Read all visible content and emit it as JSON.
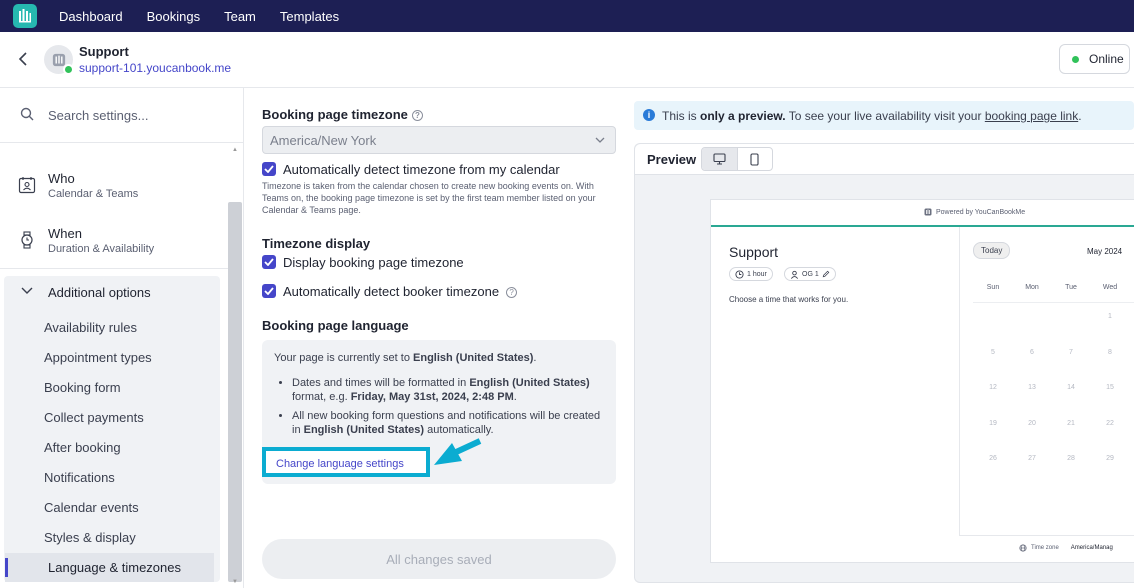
{
  "nav": {
    "items": [
      "Dashboard",
      "Bookings",
      "Team",
      "Templates"
    ]
  },
  "header": {
    "title": "Support",
    "url": "support-101.youcanbook.me",
    "status": "Online"
  },
  "sidebar": {
    "search_placeholder": "Search settings...",
    "sections": [
      {
        "title": "Who",
        "subtitle": "Calendar & Teams"
      },
      {
        "title": "When",
        "subtitle": "Duration & Availability"
      }
    ],
    "additional": {
      "title": "Additional options",
      "items": [
        "Availability rules",
        "Appointment types",
        "Booking form",
        "Collect payments",
        "After booking",
        "Notifications",
        "Calendar events",
        "Styles & display"
      ],
      "active": "Language & timezones"
    }
  },
  "settings": {
    "tz_label": "Booking page timezone",
    "tz_value": "America/New York",
    "auto_detect_label": "Automatically detect timezone from my calendar",
    "help_text": "Timezone is taken from the calendar chosen to create new booking events on. With Teams on, the booking page timezone is set by the first team member listed on your Calendar & Teams page.",
    "tz_display_label": "Timezone display",
    "display_booking_tz": "Display booking page timezone",
    "auto_detect_booker": "Automatically detect booker timezone",
    "lang_label": "Booking page language",
    "lang": {
      "intro_prefix": "Your page is currently set to ",
      "language": "English (United States)",
      "intro_suffix": ".",
      "b1_prefix": "Dates and times will be formatted in ",
      "b1_mid": " format, e.g. ",
      "b1_example": "Friday, May 31st, 2024, 2:48 PM",
      "b1_suffix": ".",
      "b2_prefix": "All new booking form questions and notifications will be created in ",
      "b2_suffix": " automatically."
    },
    "change_link": "Change language settings",
    "save_button": "All changes saved"
  },
  "preview": {
    "info_prefix": "This is ",
    "info_bold": "only a preview.",
    "info_mid": " To see your live availability visit your ",
    "info_link": "booking page link",
    "info_suffix": ".",
    "title": "Preview",
    "card": {
      "powered_by": "Powered by YouCanBookMe",
      "title": "Support",
      "duration": "1 hour",
      "team": "OG 1",
      "choose": "Choose a time that works for you.",
      "today": "Today",
      "month": "May 2024",
      "weekdays": [
        "Sun",
        "Mon",
        "Tue",
        "Wed"
      ],
      "weeks": [
        [
          "",
          "",
          "",
          "1"
        ],
        [
          "5",
          "6",
          "7",
          "8"
        ],
        [
          "12",
          "13",
          "14",
          "15"
        ],
        [
          "19",
          "20",
          "21",
          "22"
        ],
        [
          "26",
          "27",
          "28",
          "29"
        ]
      ],
      "tz_label": "Time zone",
      "tz_value": "America/Manag"
    }
  }
}
